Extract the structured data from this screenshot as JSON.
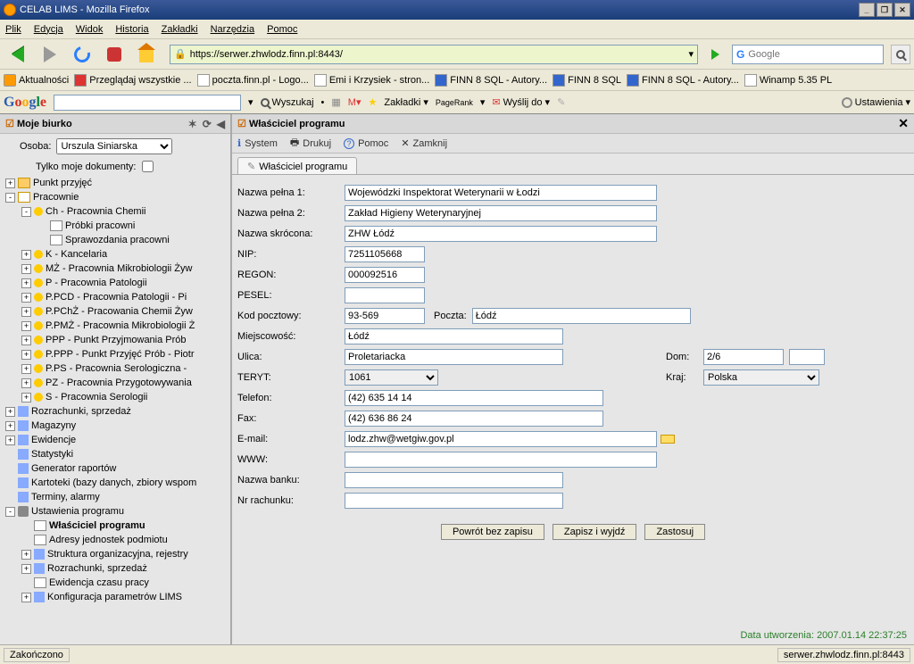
{
  "window": {
    "title": "CELAB LIMS - Mozilla Firefox"
  },
  "menu": {
    "file": "Plik",
    "edit": "Edycja",
    "view": "Widok",
    "history": "Historia",
    "bookmarks": "Zakładki",
    "tools": "Narzędzia",
    "help": "Pomoc"
  },
  "url": "https://serwer.zhwlodz.finn.pl:8443/",
  "search": {
    "placeholder": "Google"
  },
  "bookmarks_bar": [
    "Aktualności",
    "Przeglądaj wszystkie ...",
    "poczta.finn.pl - Logo...",
    "Emi i Krzysiek - stron...",
    "FINN 8 SQL - Autory...",
    "FINN 8 SQL",
    "FINN 8 SQL - Autory...",
    "Winamp 5.35 PL"
  ],
  "google_bar": {
    "search": "Wyszukaj",
    "bookmarks": "Zakładki",
    "pagerank": "PageRank",
    "send": "Wyślij do",
    "settings": "Ustawienia"
  },
  "sidebar": {
    "title": "Moje biurko",
    "osoba_label": "Osoba:",
    "osoba_value": "Urszula Siniarska",
    "only_my_docs": "Tylko moje dokumenty:"
  },
  "tree": [
    {
      "pm": "+",
      "i": 0,
      "ic": "folder",
      "lbl": "Punkt przyjęć"
    },
    {
      "pm": "-",
      "i": 0,
      "ic": "folder-open",
      "lbl": "Pracownie"
    },
    {
      "pm": "-",
      "i": 1,
      "ic": "dot-y",
      "lbl": "Ch - Pracownia Chemii"
    },
    {
      "pm": " ",
      "i": 2,
      "ic": "doc",
      "lbl": "Próbki pracowni"
    },
    {
      "pm": " ",
      "i": 2,
      "ic": "doc",
      "lbl": "Sprawozdania pracowni"
    },
    {
      "pm": "+",
      "i": 1,
      "ic": "dot-y",
      "lbl": "K - Kancelaria"
    },
    {
      "pm": "+",
      "i": 1,
      "ic": "dot-y",
      "lbl": "MŻ - Pracownia Mikrobiologii Żyw"
    },
    {
      "pm": "+",
      "i": 1,
      "ic": "dot-y",
      "lbl": "P - Pracownia Patologii"
    },
    {
      "pm": "+",
      "i": 1,
      "ic": "dot-y",
      "lbl": "P.PCD - Pracownia Patologii - Pi"
    },
    {
      "pm": "+",
      "i": 1,
      "ic": "dot-y",
      "lbl": "P.PChŻ - Pracowania Chemii Żyw"
    },
    {
      "pm": "+",
      "i": 1,
      "ic": "dot-y",
      "lbl": "P.PMŻ - Pracownia Mikrobiologii Ż"
    },
    {
      "pm": "+",
      "i": 1,
      "ic": "dot-y",
      "lbl": "PPP - Punkt Przyjmowania Prób"
    },
    {
      "pm": "+",
      "i": 1,
      "ic": "dot-y",
      "lbl": "P.PPP - Punkt Przyjęć Prób - Piotr"
    },
    {
      "pm": "+",
      "i": 1,
      "ic": "dot-y",
      "lbl": "P.PS - Pracownia Serologiczna -"
    },
    {
      "pm": "+",
      "i": 1,
      "ic": "dot-y",
      "lbl": "PZ - Pracownia Przygotowywania"
    },
    {
      "pm": "+",
      "i": 1,
      "ic": "dot-y",
      "lbl": "S - Pracownia Serologii"
    },
    {
      "pm": "+",
      "i": 0,
      "ic": "misc",
      "lbl": "Rozrachunki, sprzedaż"
    },
    {
      "pm": "+",
      "i": 0,
      "ic": "misc",
      "lbl": "Magazyny"
    },
    {
      "pm": "+",
      "i": 0,
      "ic": "misc",
      "lbl": "Ewidencje"
    },
    {
      "pm": " ",
      "i": 0,
      "ic": "misc",
      "lbl": "Statystyki"
    },
    {
      "pm": " ",
      "i": 0,
      "ic": "misc",
      "lbl": "Generator raportów"
    },
    {
      "pm": " ",
      "i": 0,
      "ic": "misc",
      "lbl": "Kartoteki (bazy danych, zbiory wspom"
    },
    {
      "pm": " ",
      "i": 0,
      "ic": "misc",
      "lbl": "Terminy, alarmy"
    },
    {
      "pm": "-",
      "i": 0,
      "ic": "gear",
      "lbl": "Ustawienia programu"
    },
    {
      "pm": " ",
      "i": 1,
      "ic": "doc",
      "lbl": "Właściciel programu",
      "bold": true
    },
    {
      "pm": " ",
      "i": 1,
      "ic": "doc",
      "lbl": "Adresy jednostek podmiotu"
    },
    {
      "pm": "+",
      "i": 1,
      "ic": "misc",
      "lbl": "Struktura organizacyjna, rejestry"
    },
    {
      "pm": "+",
      "i": 1,
      "ic": "misc",
      "lbl": "Rozrachunki, sprzedaż"
    },
    {
      "pm": " ",
      "i": 1,
      "ic": "doc",
      "lbl": "Ewidencja czasu pracy"
    },
    {
      "pm": "+",
      "i": 1,
      "ic": "misc",
      "lbl": "Konfiguracja parametrów LIMS"
    }
  ],
  "content": {
    "title": "Właściciel programu",
    "menu": {
      "system": "System",
      "print": "Drukuj",
      "help": "Pomoc",
      "close": "Zamknij"
    },
    "tab": "Właściciel programu"
  },
  "form": {
    "labels": {
      "name1": "Nazwa pełna 1:",
      "name2": "Nazwa pełna 2:",
      "short": "Nazwa skrócona:",
      "nip": "NIP:",
      "regon": "REGON:",
      "pesel": "PESEL:",
      "zip": "Kod pocztowy:",
      "post": "Poczta:",
      "city": "Miejscowość:",
      "street": "Ulica:",
      "house": "Dom:",
      "teryt": "TERYT:",
      "country": "Kraj:",
      "phone": "Telefon:",
      "fax": "Fax:",
      "email": "E-mail:",
      "www": "WWW:",
      "bank": "Nazwa banku:",
      "account": "Nr rachunku:"
    },
    "values": {
      "name1": "Wojewódzki Inspektorat Weterynarii w Łodzi",
      "name2": "Zakład Higieny Weterynaryjnej",
      "short": "ZHW Łódź",
      "nip": "7251105668",
      "regon": "000092516",
      "pesel": "",
      "zip": "93-569",
      "post": "Łódź",
      "city": "Łódź",
      "street": "Proletariacka",
      "house": "2/6",
      "house2": "",
      "teryt": "1061",
      "country": "Polska",
      "phone": "(42) 635 14 14",
      "fax": "(42) 636 86 24",
      "email": "lodz.zhw@wetgiw.gov.pl",
      "www": "",
      "bank": "",
      "account": ""
    }
  },
  "buttons": {
    "back": "Powrót bez zapisu",
    "save": "Zapisz i wyjdź",
    "apply": "Zastosuj"
  },
  "timestamp": "Data utworzenia: 2007.01.14 22:37:25",
  "status": {
    "left": "Zakończono",
    "right": "serwer.zhwlodz.finn.pl:8443"
  }
}
